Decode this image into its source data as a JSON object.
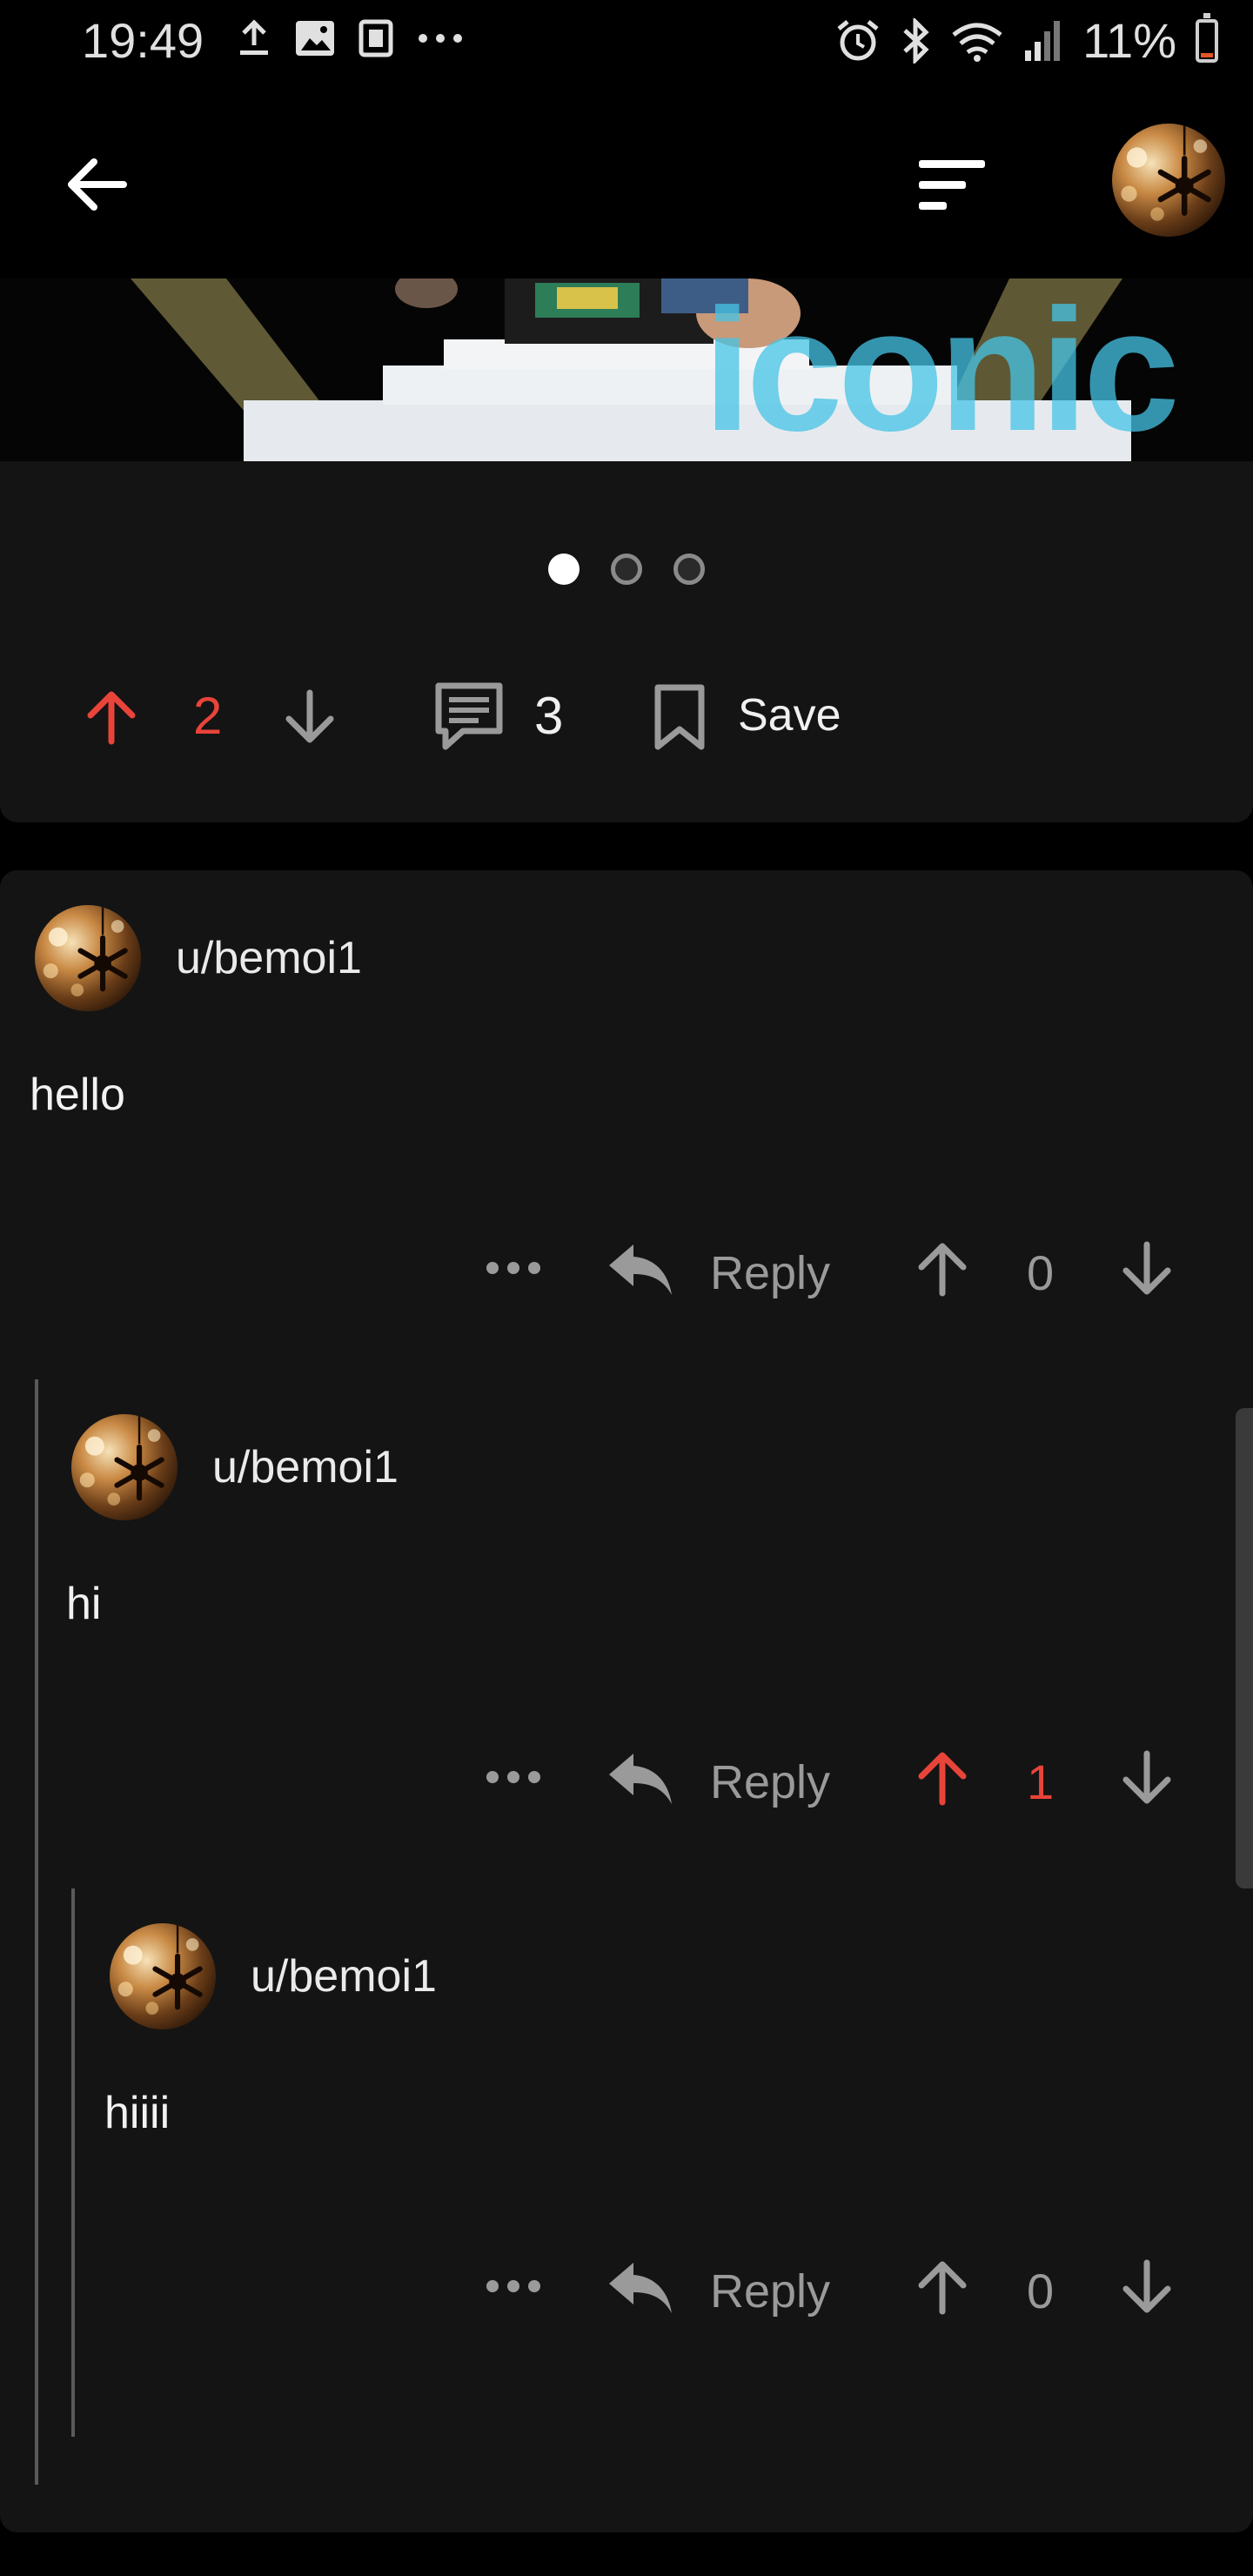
{
  "status_bar": {
    "time": "19:49",
    "left_icons": [
      "upload-icon",
      "image-icon",
      "notification-icon",
      "more-dots-icon"
    ],
    "right_icons": [
      "alarm-icon",
      "bluetooth-icon",
      "wifi-icon",
      "signal-icon"
    ],
    "battery_percent": "11%",
    "battery_level": 0.11,
    "battery_color": "#e2552b"
  },
  "app_bar": {
    "back_icon": "back-arrow-icon",
    "sort_icon": "sort-icon",
    "avatar_icon": "user-avatar-icon"
  },
  "media": {
    "watermark": "iconic"
  },
  "post": {
    "carousel": {
      "count": 3,
      "active_index": 0
    },
    "score": "2",
    "upvoted": true,
    "comments_count": "3",
    "save_label": "Save"
  },
  "comments": [
    {
      "username": "u/bemoi1",
      "body": "hello",
      "reply_label": "Reply",
      "score": "0",
      "upvoted": false
    },
    {
      "username": "u/bemoi1",
      "body": "hi",
      "reply_label": "Reply",
      "score": "1",
      "upvoted": true
    },
    {
      "username": "u/bemoi1",
      "body": "hiiii",
      "reply_label": "Reply",
      "score": "0",
      "upvoted": false
    }
  ],
  "colors": {
    "background": "#000000",
    "card": "#141414",
    "upvote_active": "#e8443a",
    "muted": "#9a9a9a",
    "text": "#f2f2f2"
  }
}
